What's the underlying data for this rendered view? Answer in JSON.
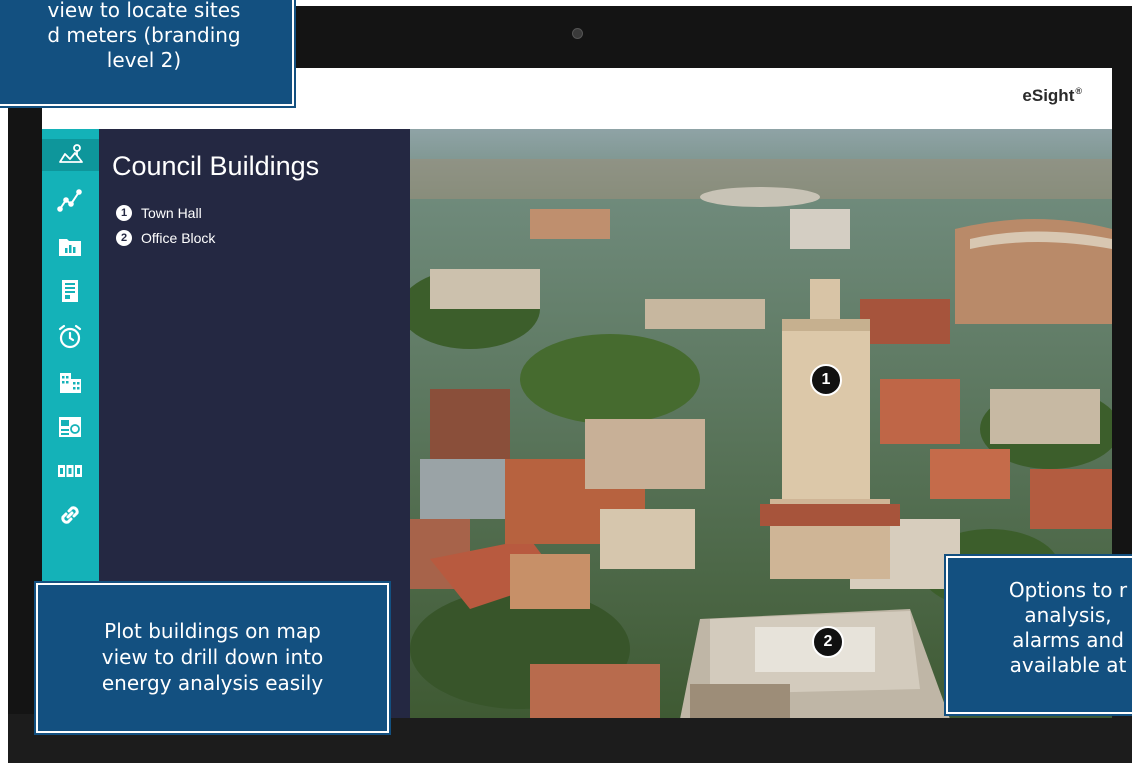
{
  "app": {
    "brand": "eSight",
    "brand_mark": "®"
  },
  "panel": {
    "title": "Council Buildings",
    "buildings": [
      {
        "number": "1",
        "name": "Town Hall"
      },
      {
        "number": "2",
        "name": "Office Block"
      }
    ]
  },
  "map": {
    "markers": [
      "1",
      "2"
    ]
  },
  "nav": {
    "icons": [
      "map-pin-icon",
      "line-chart-icon",
      "bar-chart-folder-icon",
      "report-icon",
      "alarm-clock-icon",
      "buildings-icon",
      "dashboard-icon",
      "counter-icon",
      "link-icon"
    ]
  },
  "callouts": {
    "top_line1": "view to locate sites",
    "top_line2": "d meters (branding",
    "top_line3": "level 2)",
    "left_line1": "Plot buildings on map",
    "left_line2": "view to drill down into",
    "left_line3": "energy analysis easily",
    "right_line1": "Options to r",
    "right_line2": "analysis,",
    "right_line3": "alarms and",
    "right_line4": "available at"
  },
  "colors": {
    "accent": "#14b2b8",
    "panel": "#242842",
    "callout": "#135080"
  }
}
